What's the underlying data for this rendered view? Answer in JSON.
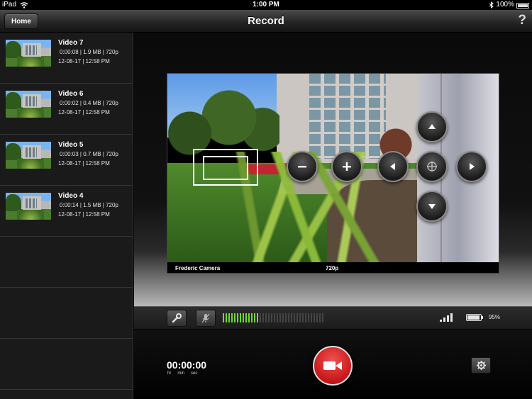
{
  "status_bar": {
    "device": "iPad",
    "time": "1:00 PM",
    "battery": "100%"
  },
  "nav": {
    "home_label": "Home",
    "title": "Record",
    "help_label": "?"
  },
  "sidebar": {
    "videos": [
      {
        "title": "Video 7",
        "meta": "0:00:08 | 1.9 MB | 720p",
        "date": "12-08-17 | 12:58 PM"
      },
      {
        "title": "Video 6",
        "meta": "0:00:02 | 0.4 MB | 720p",
        "date": "12-08-17 | 12:58 PM"
      },
      {
        "title": "Video 5",
        "meta": "0:00:03 | 0.7 MB | 720p",
        "date": "12-08-17 | 12:58 PM"
      },
      {
        "title": "Video 4",
        "meta": "0:00:14 | 1.5 MB | 720p",
        "date": "12-08-17 | 12:58 PM"
      }
    ]
  },
  "preview": {
    "camera_name": "Frederic Camera",
    "resolution": "720p"
  },
  "controls": {
    "zoom_out": "zoom-out",
    "zoom_in": "zoom-in",
    "pan_left": "pan-left",
    "pan_right": "pan-right",
    "tilt_up": "tilt-up",
    "tilt_down": "tilt-down",
    "center": "center"
  },
  "toolbar": {
    "audio_level_fraction": 0.36,
    "battery_percent": "95%"
  },
  "recording": {
    "timer": "00:00:00",
    "unit_hr": "hr",
    "unit_min": "min",
    "unit_sec": "sec"
  },
  "colors": {
    "record_red": "#d81f22",
    "meter_green": "#6fd93a"
  }
}
